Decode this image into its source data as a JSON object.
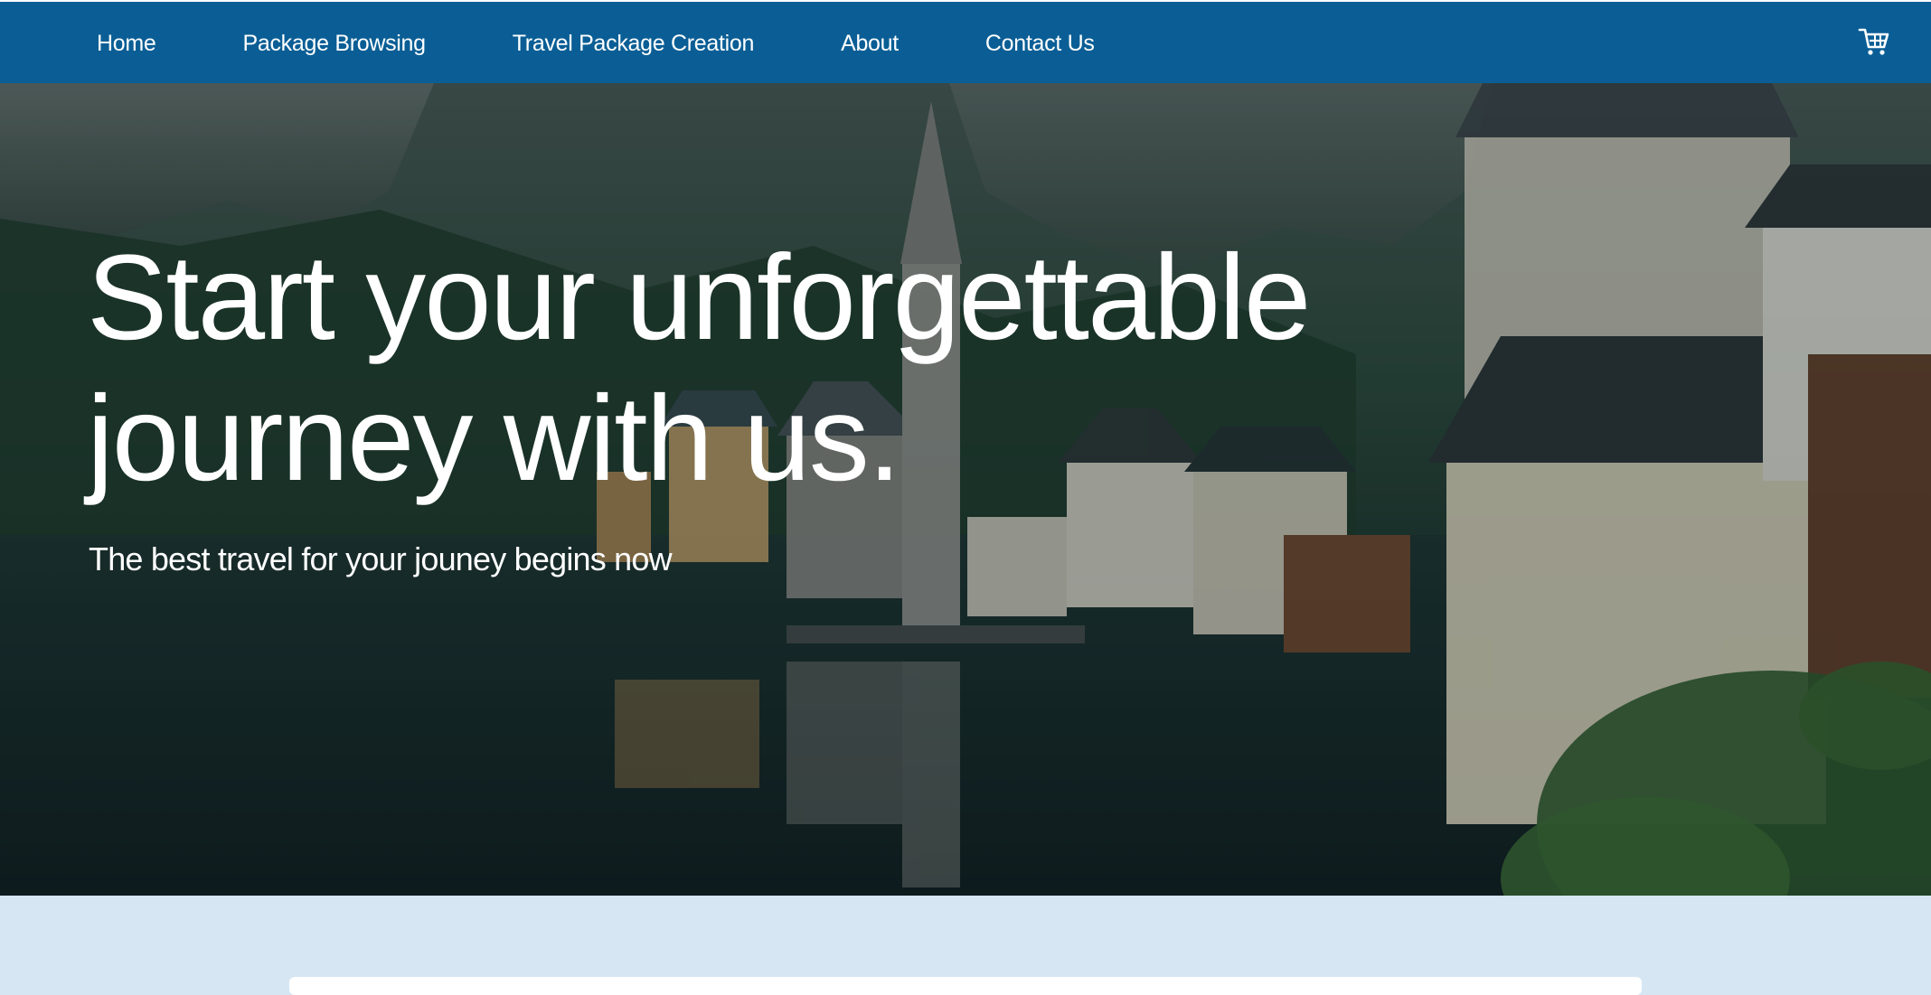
{
  "colors": {
    "nav_bg": "#0a5e95",
    "lower_bg": "#d6e6f3",
    "text": "#ffffff"
  },
  "nav": {
    "items": [
      {
        "label": "Home"
      },
      {
        "label": "Package Browsing"
      },
      {
        "label": "Travel Package Creation"
      },
      {
        "label": "About"
      },
      {
        "label": "Contact Us"
      }
    ],
    "cart_icon": "shopping-cart-icon"
  },
  "hero": {
    "title_line1": "Start your unforgettable",
    "title_line2": "journey with us.",
    "subtitle": "The best travel for your jouney begins now",
    "image": "lakeside village with church spire and mountains"
  }
}
